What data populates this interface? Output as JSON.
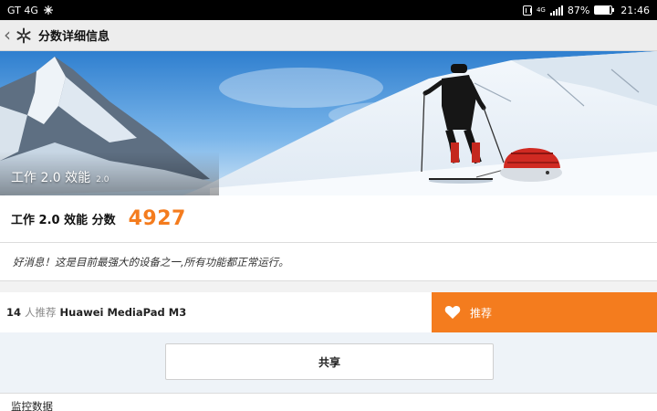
{
  "statusbar": {
    "carrier": "GT 4G",
    "network": "4G",
    "battery": "87%",
    "battery_level": 0.87,
    "time": "21:46"
  },
  "appbar": {
    "back_icon": "chevron-left-icon",
    "logo_icon": "snowflake-icon",
    "title": "分数详细信息"
  },
  "hero": {
    "label": "工作 2.0 效能",
    "version": "2.0"
  },
  "score": {
    "label": "工作 2.0 效能 分数",
    "value": "4927"
  },
  "message": "好消息！这是目前最强大的设备之一,所有功能都正常运行。",
  "recommend": {
    "count": "14",
    "count_label": "人推荐",
    "device": "Huawei MediaPad M3",
    "button_label": "推荐",
    "button_icon": "heart-icon"
  },
  "share": {
    "label": "共享"
  },
  "monitor": {
    "label": "监控数据"
  },
  "colors": {
    "accent": "#f47c1e",
    "background": "#f2f2f2",
    "share_area": "#eef3f8"
  }
}
